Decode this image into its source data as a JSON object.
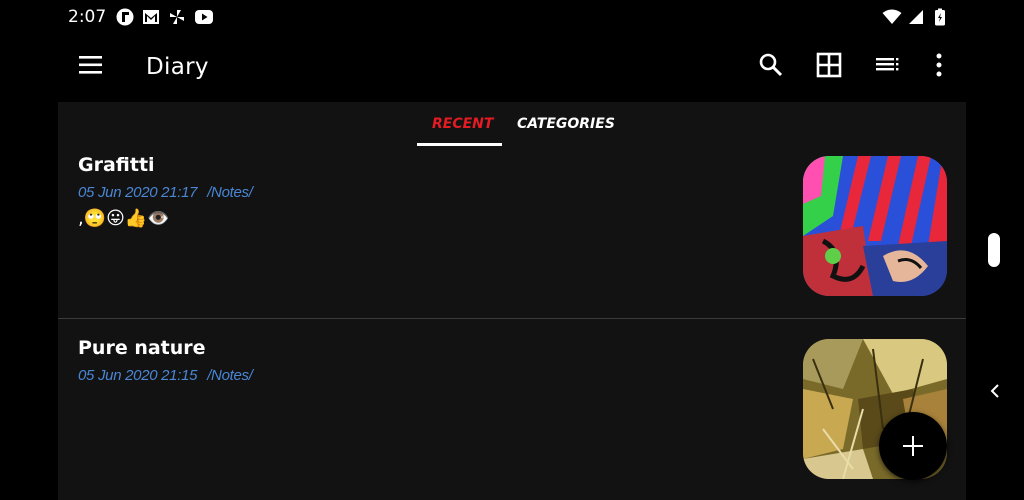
{
  "status_bar": {
    "time": "2:07",
    "left_icons": [
      "fitbit-icon",
      "gmail-icon",
      "pinwheel-icon",
      "youtube-icon"
    ],
    "right_icons": [
      "wifi-icon",
      "signal-icon",
      "battery-icon"
    ]
  },
  "toolbar": {
    "title": "Diary",
    "actions": [
      "search-icon",
      "grid-view-icon",
      "list-view-icon",
      "more-vert-icon"
    ]
  },
  "tabs": [
    {
      "label": "RECENT",
      "active": true
    },
    {
      "label": "CATEGORIES",
      "active": false
    }
  ],
  "entries": [
    {
      "title": "Grafitti",
      "date": "05 Jun 2020 21:17",
      "category": "/Notes/",
      "body": ",🙄😛👍👁️"
    },
    {
      "title": "Pure nature",
      "date": "05 Jun 2020 21:15",
      "category": "/Notes/",
      "body": ""
    }
  ],
  "colors": {
    "accent_red": "#e31b23",
    "meta_blue": "#4a86d4",
    "panel_bg": "#121212"
  }
}
